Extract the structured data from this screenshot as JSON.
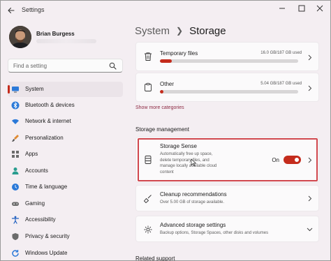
{
  "window": {
    "title": "Settings"
  },
  "user": {
    "name": "Brian Burgess"
  },
  "search": {
    "placeholder": "Find a setting"
  },
  "sidebar": {
    "items": [
      {
        "label": "System",
        "icon": "monitor-icon",
        "active": true
      },
      {
        "label": "Bluetooth & devices",
        "icon": "bluetooth-icon"
      },
      {
        "label": "Network & internet",
        "icon": "wifi-icon"
      },
      {
        "label": "Personalization",
        "icon": "paintbrush-icon"
      },
      {
        "label": "Apps",
        "icon": "apps-icon"
      },
      {
        "label": "Accounts",
        "icon": "person-icon"
      },
      {
        "label": "Time & language",
        "icon": "globe-clock-icon"
      },
      {
        "label": "Gaming",
        "icon": "gamepad-icon"
      },
      {
        "label": "Accessibility",
        "icon": "accessibility-icon"
      },
      {
        "label": "Privacy & security",
        "icon": "shield-icon"
      },
      {
        "label": "Windows Update",
        "icon": "update-icon"
      }
    ]
  },
  "breadcrumb": {
    "parent": "System",
    "current": "Storage"
  },
  "storage_items": [
    {
      "title": "Temporary files",
      "size": "16.0 GB/187 GB used",
      "fraction": 0.086,
      "icon": "trash-icon"
    },
    {
      "title": "Other",
      "size": "5.04 GB/187 GB used",
      "fraction": 0.027,
      "icon": "clipboard-icon"
    }
  ],
  "show_more": "Show more categories",
  "management": {
    "heading": "Storage management",
    "storage_sense": {
      "title": "Storage Sense",
      "description": [
        "Automatically free up space,",
        "delete temporary files, and",
        "manage locally available cloud",
        "content"
      ],
      "state_label": "On",
      "enabled": true
    },
    "cleanup": {
      "title": "Cleanup recommendations",
      "description": "Over 5.00 GB of storage available."
    },
    "advanced": {
      "title": "Advanced storage settings",
      "description": "Backup options, Storage Spaces, other disks and volumes"
    }
  },
  "related_support": {
    "heading": "Related support"
  },
  "colors": {
    "accent": "#c42b1c",
    "highlight": "#d0464d",
    "background": "#f4eef2"
  }
}
